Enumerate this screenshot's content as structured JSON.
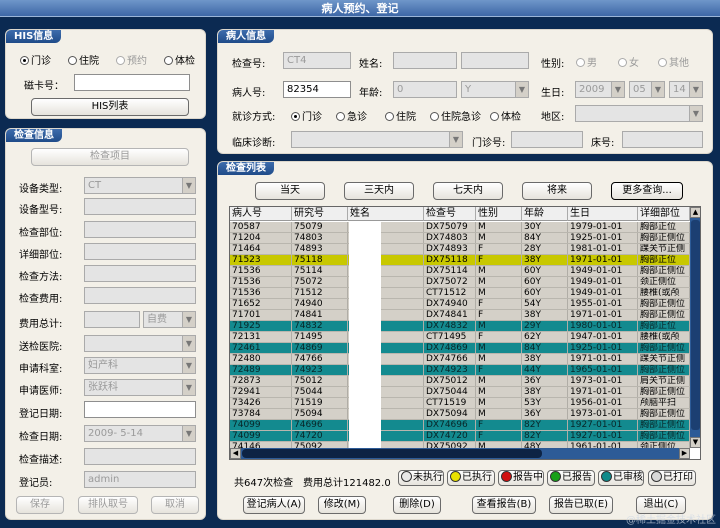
{
  "window": {
    "title": "病人预约、登记"
  },
  "his": {
    "title": "HIS信息",
    "radios": [
      {
        "label": "门诊",
        "checked": true
      },
      {
        "label": "住院",
        "checked": false
      },
      {
        "label": "预约",
        "checked": false,
        "disabled": true
      },
      {
        "label": "体检",
        "checked": false
      }
    ],
    "card_label": "磁卡号：",
    "card_value": "",
    "his_list_button": "HIS列表"
  },
  "exam_info": {
    "title": "检查信息",
    "item_button": "检查项目",
    "fields": [
      {
        "label": "设备类型:",
        "value": "CT",
        "type": "combo"
      },
      {
        "label": "设备型号:",
        "value": "",
        "type": "input"
      },
      {
        "label": "检查部位:",
        "value": "",
        "type": "input"
      },
      {
        "label": "详细部位:",
        "value": "",
        "type": "input"
      },
      {
        "label": "检查方法:",
        "value": "",
        "type": "input"
      },
      {
        "label": "检查费用:",
        "value": "",
        "type": "input"
      }
    ],
    "fee_total_label": "费用总计:",
    "fee_type": "自费",
    "send_hospital_label": "送检医院:",
    "apply_dept_label": "申请科室:",
    "apply_dept": "妇产科",
    "apply_doctor_label": "申请医师:",
    "apply_doctor": "张跃科",
    "reg_date_label": "登记日期:",
    "exam_date_label": "检查日期:",
    "exam_date": "2009- 5-14",
    "exam_desc_label": "检查描述:",
    "registrar_label": "登记员:",
    "registrar": "admin",
    "save_button": "保存",
    "queue_button": "排队取号",
    "cancel_button": "取消"
  },
  "patient": {
    "title": "病人信息",
    "exam_no_label": "检查号:",
    "exam_no": "CT4",
    "name_label": "姓名:",
    "name": "",
    "gender_label": "性别:",
    "genders": [
      "男",
      "女",
      "其他"
    ],
    "patient_no_label": "病人号:",
    "patient_no": "82354",
    "age_label": "年龄:",
    "age": "0",
    "age_unit": "Y",
    "birth_label": "生日:",
    "birth_year": "2009",
    "birth_month": "05",
    "birth_day": "14",
    "visit_label": "就诊方式:",
    "visit_options": [
      {
        "label": "门诊",
        "checked": true
      },
      {
        "label": "急诊",
        "checked": false
      },
      {
        "label": "住院",
        "checked": false
      },
      {
        "label": "住院急诊",
        "checked": false
      },
      {
        "label": "体检",
        "checked": false
      }
    ],
    "region_label": "地区:",
    "diagnosis_label": "临床诊断:",
    "clinic_no_label": "门诊号:",
    "bed_no_label": "床号:"
  },
  "exam_list": {
    "title": "检查列表",
    "filters": [
      "当天",
      "三天内",
      "七天内",
      "将来",
      "更多查询..."
    ],
    "columns": [
      "病人号",
      "研究号",
      "姓名",
      "检查号",
      "性别",
      "年龄",
      "生日",
      "详细部位"
    ],
    "rows": [
      {
        "c": [
          "70587",
          "75079",
          "",
          "DX75079",
          "M",
          "30Y",
          "1979-01-01",
          "胸部正位"
        ],
        "s": "normal"
      },
      {
        "c": [
          "71204",
          "74803",
          "",
          "DX74803",
          "M",
          "84Y",
          "1925-01-01",
          "胸部正侧位"
        ],
        "s": "normal"
      },
      {
        "c": [
          "71464",
          "74893",
          "",
          "DX74893",
          "F",
          "28Y",
          "1981-01-01",
          "踝关节正侧"
        ],
        "s": "normal"
      },
      {
        "c": [
          "71523",
          "75118",
          "",
          "DX75118",
          "F",
          "38Y",
          "1971-01-01",
          "胸部正位"
        ],
        "s": "yellow"
      },
      {
        "c": [
          "71536",
          "75114",
          "",
          "DX75114",
          "M",
          "60Y",
          "1949-01-01",
          "胸部正侧位"
        ],
        "s": "normal"
      },
      {
        "c": [
          "71536",
          "75072",
          "",
          "DX75072",
          "M",
          "60Y",
          "1949-01-01",
          "颈正侧位"
        ],
        "s": "normal"
      },
      {
        "c": [
          "71536",
          "71512",
          "",
          "CT71512",
          "M",
          "60Y",
          "1949-01-01",
          "腰椎(或颅"
        ],
        "s": "normal"
      },
      {
        "c": [
          "71652",
          "74940",
          "",
          "DX74940",
          "F",
          "54Y",
          "1955-01-01",
          "胸部正侧位"
        ],
        "s": "normal"
      },
      {
        "c": [
          "71701",
          "74841",
          "",
          "DX74841",
          "F",
          "38Y",
          "1971-01-01",
          "胸部正侧位"
        ],
        "s": "normal"
      },
      {
        "c": [
          "71925",
          "74832",
          "",
          "DX74832",
          "M",
          "29Y",
          "1980-01-01",
          "胸部正位"
        ],
        "s": "teal"
      },
      {
        "c": [
          "72131",
          "71495",
          "",
          "CT71495",
          "F",
          "62Y",
          "1947-01-01",
          "腰椎(或颅"
        ],
        "s": "normal"
      },
      {
        "c": [
          "72461",
          "74869",
          "",
          "DX74869",
          "M",
          "84Y",
          "1925-01-01",
          "胸部正侧位"
        ],
        "s": "teal"
      },
      {
        "c": [
          "72480",
          "74766",
          "",
          "DX74766",
          "M",
          "38Y",
          "1971-01-01",
          "踝关节正侧"
        ],
        "s": "normal"
      },
      {
        "c": [
          "72489",
          "74923",
          "",
          "DX74923",
          "F",
          "44Y",
          "1965-01-01",
          "胸部正侧位"
        ],
        "s": "teal"
      },
      {
        "c": [
          "72873",
          "75012",
          "",
          "DX75012",
          "M",
          "36Y",
          "1973-01-01",
          "肩关节正侧"
        ],
        "s": "normal"
      },
      {
        "c": [
          "72941",
          "75044",
          "",
          "DX75044",
          "M",
          "38Y",
          "1971-01-01",
          "胸部正侧位"
        ],
        "s": "normal"
      },
      {
        "c": [
          "73426",
          "71519",
          "",
          "CT71519",
          "M",
          "53Y",
          "1956-01-01",
          "颅脑平扫"
        ],
        "s": "normal"
      },
      {
        "c": [
          "73784",
          "75094",
          "",
          "DX75094",
          "M",
          "36Y",
          "1973-01-01",
          "胸部正侧位"
        ],
        "s": "normal"
      },
      {
        "c": [
          "74099",
          "74696",
          "",
          "DX74696",
          "F",
          "82Y",
          "1927-01-01",
          "胸部正侧位"
        ],
        "s": "teal"
      },
      {
        "c": [
          "74099",
          "74720",
          "",
          "DX74720",
          "F",
          "82Y",
          "1927-01-01",
          "胸部正侧位"
        ],
        "s": "teal"
      },
      {
        "c": [
          "74146",
          "75092",
          "",
          "DX75092",
          "M",
          "48Y",
          "1961-01-01",
          "颈正侧位"
        ],
        "s": "normal"
      }
    ],
    "summary_count": "共647次检查",
    "summary_fee": "费用总计121482.0",
    "legend": [
      {
        "label": "未执行",
        "color": "#e8e8e8"
      },
      {
        "label": "已执行",
        "color": "#e8e000"
      },
      {
        "label": "报告中",
        "color": "#d01010"
      },
      {
        "label": "已报告",
        "color": "#18a018"
      },
      {
        "label": "已审核",
        "color": "#108a8a"
      },
      {
        "label": "已打印",
        "color": "#d8d8d8"
      }
    ],
    "actions": [
      "登记病人(A)",
      "修改(M)",
      "删除(D)",
      "查看报告(B)",
      "报告已取(E)",
      "退出(C)"
    ]
  },
  "watermark": "@稀土掘金技术社区"
}
